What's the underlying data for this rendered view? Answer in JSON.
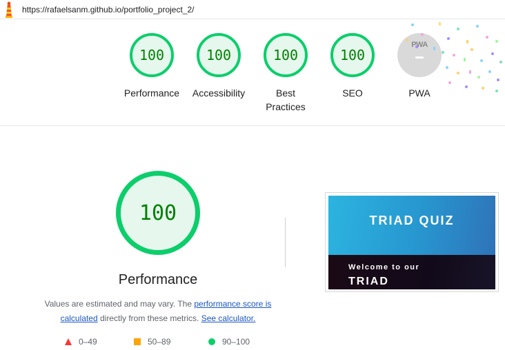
{
  "url": "https://rafaelsanm.github.io/portfolio_project_2/",
  "gauges": [
    {
      "score": "100",
      "label": "Performance"
    },
    {
      "score": "100",
      "label": "Accessibility"
    },
    {
      "score": "100",
      "label": "Best Practices"
    },
    {
      "score": "100",
      "label": "SEO"
    }
  ],
  "pwa": {
    "badge_text": "PWA",
    "label": "PWA"
  },
  "performance": {
    "score": "100",
    "title": "Performance",
    "desc_prefix": "Values are estimated and may vary. The ",
    "desc_link1": "performance score is calculated",
    "desc_middle": " directly from these metrics. ",
    "desc_link2": "See calculator."
  },
  "legend": {
    "fail": "0–49",
    "average": "50–89",
    "pass": "90–100"
  },
  "thumbnail": {
    "title": "TRIAD QUIZ",
    "welcome": "Welcome to our",
    "subtitle": "TRIAD"
  },
  "colors": {
    "pass": "#0cce6b",
    "average": "#ffa400",
    "fail": "#ff3333",
    "score_text": "#008000",
    "link": "#1a56c5"
  }
}
